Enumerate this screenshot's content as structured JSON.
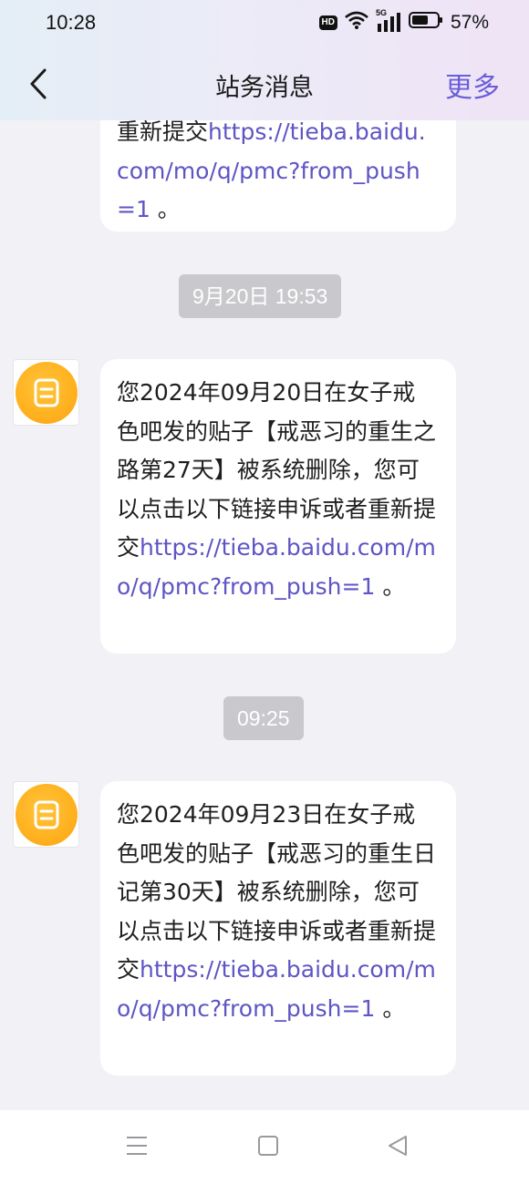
{
  "status_bar": {
    "time": "10:28",
    "hd": "HD",
    "network": "5G",
    "battery": "57%"
  },
  "nav": {
    "title": "站务消息",
    "more": "更多",
    "back_icon": "chevron-left-icon"
  },
  "messages": [
    {
      "lines": [
        "重新提交"
      ],
      "prefix": "重新提交",
      "link": "https://tieba.baidu.com/mo/q/pmc?from_push=1",
      "suffix": " 。",
      "truncated": true
    },
    {
      "time": "9月20日 19:53",
      "text": "您2024年09月20日在女子戒色吧发的贴子【戒恶习的重生之路第27天】被系统删除，您可以点击以下链接申诉或者重新提交",
      "link": "https://tieba.baidu.com/mo/q/pmc?from_push=1",
      "suffix": " 。"
    },
    {
      "time": "09:25",
      "text": "您2024年09月23日在女子戒色吧发的贴子【戒恶习的重生日记第30天】被系统删除，您可以点击以下链接申诉或者重新提交",
      "link": "https://tieba.baidu.com/mo/q/pmc?from_push=1",
      "suffix": " 。"
    }
  ],
  "bottom_nav": {
    "icons": [
      "menu-icon",
      "home-square-icon",
      "back-triangle-icon"
    ]
  },
  "colors": {
    "accent": "#6a5ed8",
    "link": "#5e55c4",
    "avatar": "#ffb11f",
    "chip": "#c9c9cd"
  }
}
